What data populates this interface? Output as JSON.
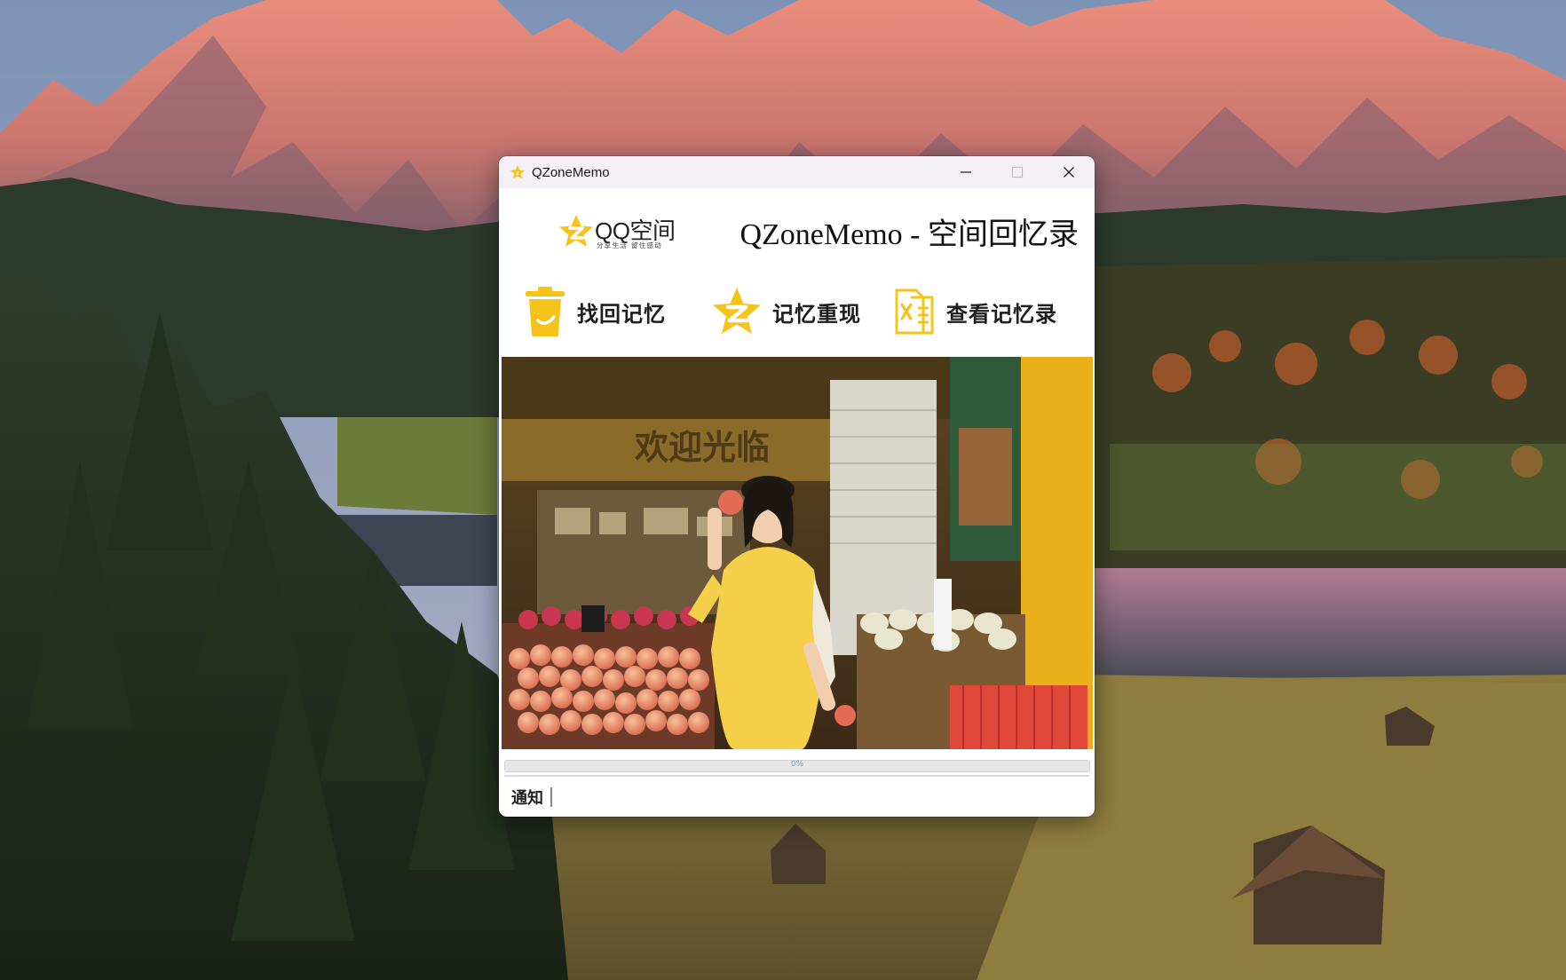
{
  "window": {
    "title": "QZoneMemo",
    "minimize_icon": "minimize-icon",
    "maximize_icon": "maximize-icon",
    "close_icon": "close-icon"
  },
  "header": {
    "logo_word": "QQ空间",
    "logo_subtitle": "分享生活 留住感动",
    "app_title": "QZoneMemo - 空间回忆录"
  },
  "menu": [
    {
      "label": "找回记忆",
      "icon": "yellow-bin-icon"
    },
    {
      "label": "记忆重现",
      "icon": "qzone-star-icon"
    },
    {
      "label": "查看记忆录",
      "icon": "excel-doc-icon"
    }
  ],
  "photo": {
    "sign_text": "欢迎光临"
  },
  "progress": {
    "value": 0,
    "text": "0%"
  },
  "notice": {
    "label": "通知",
    "value": ""
  },
  "colors": {
    "accent_yellow": "#f6c31a",
    "titlebar": "#f3eff5",
    "progress_fill": "#3a8ee6"
  }
}
